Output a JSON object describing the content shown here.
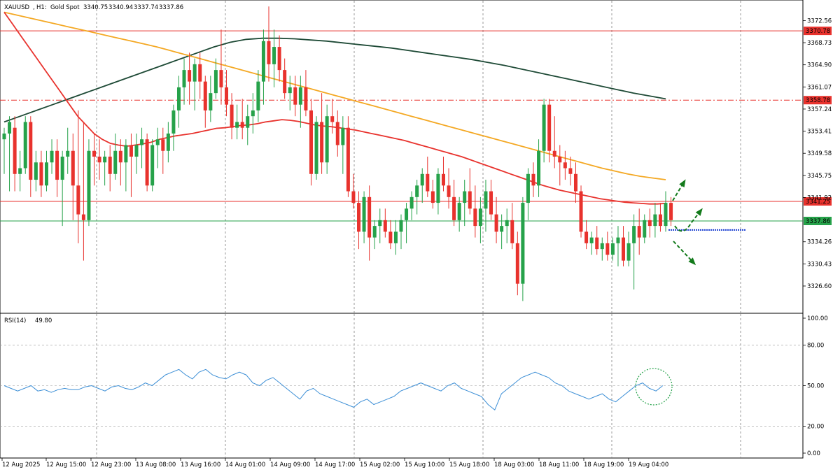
{
  "header": {
    "symbol": "XAUUSD",
    "timeframe": "H1",
    "description": "Gold Spot",
    "open": "3340.75",
    "high": "3340.94",
    "low": "3337.74",
    "close": "3337.86"
  },
  "rsi_header": {
    "name": "RSI(14)",
    "value": "49.80"
  },
  "colors": {
    "bull": "#26a24a",
    "bear": "#e8322d",
    "ma_red": "#e8322d",
    "ma_orange": "#f4a823",
    "ma_dark": "#1e4a36",
    "rsi_line": "#3d8fd6",
    "resistance": "#e8322d",
    "support": "#26a24a",
    "arrow": "#137a1b"
  },
  "price_labels": [
    "3372.56",
    "3368.73",
    "3364.90",
    "3361.07",
    "3357.24",
    "3353.41",
    "3349.58",
    "3345.75",
    "3341.92",
    "3334.26",
    "3330.43",
    "3326.60"
  ],
  "level_labels": [
    {
      "text": "3370.78",
      "price": 3370.78,
      "style": "solid",
      "color": "#e8322d"
    },
    {
      "text": "3358.78",
      "price": 3358.78,
      "style": "dashdot",
      "color": "#e8322d"
    },
    {
      "text": "3341.25",
      "price": 3341.25,
      "style": "solid",
      "color": "#e8322d"
    },
    {
      "text": "3337.86",
      "price": 3337.86,
      "style": "solid",
      "color": "#26a24a"
    }
  ],
  "rsi_labels": [
    "100.00",
    "80.00",
    "50.00",
    "20.00",
    "0.00"
  ],
  "time_labels": [
    "12 Aug 2025",
    "12 Aug 15:00",
    "12 Aug 23:00",
    "13 Aug 08:00",
    "13 Aug 16:00",
    "14 Aug 01:00",
    "14 Aug 09:00",
    "14 Aug 17:00",
    "15 Aug 02:00",
    "15 Aug 10:00",
    "15 Aug 18:00",
    "18 Aug 03:00",
    "18 Aug 11:00",
    "18 Aug 19:00",
    "19 Aug 04:00"
  ],
  "chart_data": {
    "type": "candlestick",
    "ylim": [
      3322.0,
      3376.0
    ],
    "rsi_ylim": [
      0,
      100
    ],
    "candles": [
      [
        3352,
        3354,
        3346,
        3353
      ],
      [
        3353,
        3356,
        3343,
        3355
      ],
      [
        3354,
        3356,
        3343,
        3346
      ],
      [
        3346,
        3350,
        3343,
        3347
      ],
      [
        3347,
        3356,
        3346,
        3355
      ],
      [
        3355,
        3356,
        3342,
        3345
      ],
      [
        3345,
        3350,
        3343,
        3348
      ],
      [
        3348,
        3350,
        3342,
        3344
      ],
      [
        3344,
        3350,
        3343,
        3348
      ],
      [
        3348,
        3352,
        3346,
        3350
      ],
      [
        3350,
        3352,
        3342,
        3345
      ],
      [
        3345,
        3350,
        3337,
        3349
      ],
      [
        3349,
        3354,
        3346,
        3350
      ],
      [
        3350,
        3353,
        3338,
        3344
      ],
      [
        3344,
        3357,
        3334,
        3339
      ],
      [
        3339,
        3355,
        3331,
        3338
      ],
      [
        3338,
        3352,
        3337,
        3350
      ],
      [
        3350,
        3353,
        3344,
        3349
      ],
      [
        3349,
        3352,
        3345,
        3348
      ],
      [
        3348,
        3350,
        3344,
        3349
      ],
      [
        3349,
        3351,
        3343,
        3346
      ],
      [
        3346,
        3353,
        3345,
        3350
      ],
      [
        3350,
        3352,
        3344,
        3348
      ],
      [
        3348,
        3352,
        3343,
        3351
      ],
      [
        3351,
        3353,
        3342,
        3349
      ],
      [
        3349,
        3353,
        3346,
        3351
      ],
      [
        3351,
        3354,
        3347,
        3352
      ],
      [
        3352,
        3353,
        3343,
        3344
      ],
      [
        3344,
        3352,
        3343,
        3351
      ],
      [
        3351,
        3354,
        3347,
        3352
      ],
      [
        3352,
        3354,
        3346,
        3350
      ],
      [
        3350,
        3355,
        3348,
        3353
      ],
      [
        3353,
        3358,
        3350,
        3357
      ],
      [
        3357,
        3363,
        3354,
        3361
      ],
      [
        3361,
        3366,
        3358,
        3364
      ],
      [
        3364,
        3367,
        3358,
        3362
      ],
      [
        3362,
        3366,
        3357,
        3365
      ],
      [
        3365,
        3367,
        3359,
        3362
      ],
      [
        3362,
        3363,
        3354,
        3357
      ],
      [
        3357,
        3363,
        3355,
        3360
      ],
      [
        3360,
        3366,
        3359,
        3364
      ],
      [
        3364,
        3371,
        3358,
        3361
      ],
      [
        3361,
        3364,
        3356,
        3358
      ],
      [
        3358,
        3360,
        3352,
        3354
      ],
      [
        3354,
        3358,
        3352,
        3355
      ],
      [
        3355,
        3359,
        3352,
        3354
      ],
      [
        3354,
        3358,
        3351,
        3356
      ],
      [
        3356,
        3360,
        3353,
        3357
      ],
      [
        3357,
        3364,
        3355,
        3362
      ],
      [
        3362,
        3371,
        3358,
        3369
      ],
      [
        3369,
        3375,
        3362,
        3365
      ],
      [
        3365,
        3371,
        3361,
        3368
      ],
      [
        3368,
        3370,
        3362,
        3364
      ],
      [
        3364,
        3366,
        3359,
        3360
      ],
      [
        3360,
        3363,
        3357,
        3361
      ],
      [
        3361,
        3363,
        3356,
        3358
      ],
      [
        3358,
        3363,
        3354,
        3361
      ],
      [
        3361,
        3364,
        3356,
        3357
      ],
      [
        3357,
        3359,
        3344,
        3346
      ],
      [
        3346,
        3356,
        3345,
        3355
      ],
      [
        3355,
        3360,
        3346,
        3348
      ],
      [
        3348,
        3358,
        3346,
        3356
      ],
      [
        3356,
        3359,
        3353,
        3355
      ],
      [
        3355,
        3357,
        3349,
        3351
      ],
      [
        3351,
        3356,
        3346,
        3354
      ],
      [
        3354,
        3356,
        3342,
        3343
      ],
      [
        3343,
        3346,
        3340,
        3341
      ],
      [
        3341,
        3343,
        3333,
        3336
      ],
      [
        3336,
        3343,
        3334,
        3342
      ],
      [
        3342,
        3344,
        3331,
        3335
      ],
      [
        3335,
        3338,
        3333,
        3337
      ],
      [
        3337,
        3340,
        3334,
        3338
      ],
      [
        3338,
        3340,
        3335,
        3336
      ],
      [
        3336,
        3338,
        3333,
        3334
      ],
      [
        3334,
        3338,
        3332,
        3336
      ],
      [
        3336,
        3339,
        3333,
        3338
      ],
      [
        3338,
        3341,
        3334,
        3340
      ],
      [
        3340,
        3343,
        3338,
        3342
      ],
      [
        3342,
        3345,
        3339,
        3344
      ],
      [
        3344,
        3347,
        3341,
        3346
      ],
      [
        3346,
        3349,
        3342,
        3343
      ],
      [
        3343,
        3345,
        3340,
        3341
      ],
      [
        3341,
        3347,
        3339,
        3346
      ],
      [
        3346,
        3349,
        3343,
        3344
      ],
      [
        3344,
        3347,
        3340,
        3342
      ],
      [
        3342,
        3345,
        3337,
        3338
      ],
      [
        3338,
        3342,
        3336,
        3341
      ],
      [
        3341,
        3345,
        3337,
        3343
      ],
      [
        3343,
        3347,
        3339,
        3340
      ],
      [
        3340,
        3344,
        3335,
        3337
      ],
      [
        3337,
        3342,
        3334,
        3340
      ],
      [
        3340,
        3345,
        3336,
        3343
      ],
      [
        3343,
        3345,
        3338,
        3339
      ],
      [
        3339,
        3342,
        3334,
        3336
      ],
      [
        3336,
        3339,
        3333,
        3337
      ],
      [
        3337,
        3340,
        3334,
        3338
      ],
      [
        3338,
        3341,
        3333,
        3334
      ],
      [
        3334,
        3336,
        3325,
        3327
      ],
      [
        3327,
        3342,
        3324,
        3341
      ],
      [
        3341,
        3347,
        3338,
        3346
      ],
      [
        3346,
        3348,
        3342,
        3344
      ],
      [
        3344,
        3352,
        3342,
        3350
      ],
      [
        3350,
        3359,
        3348,
        3358
      ],
      [
        3358,
        3359,
        3348,
        3350
      ],
      [
        3350,
        3356,
        3347,
        3349
      ],
      [
        3349,
        3351,
        3344,
        3348
      ],
      [
        3348,
        3350,
        3345,
        3347
      ],
      [
        3347,
        3349,
        3344,
        3346
      ],
      [
        3346,
        3348,
        3341,
        3343
      ],
      [
        3343,
        3344,
        3335,
        3336
      ],
      [
        3336,
        3338,
        3333,
        3334
      ],
      [
        3334,
        3336,
        3332,
        3335
      ],
      [
        3335,
        3337,
        3332,
        3333
      ],
      [
        3333,
        3335,
        3331,
        3334
      ],
      [
        3334,
        3336,
        3331,
        3332
      ],
      [
        3332,
        3335,
        3331,
        3334
      ],
      [
        3334,
        3337,
        3330,
        3335
      ],
      [
        3335,
        3337,
        3330,
        3331
      ],
      [
        3331,
        3336,
        3330,
        3334
      ],
      [
        3334,
        3339,
        3326,
        3337
      ],
      [
        3337,
        3340,
        3332,
        3335
      ],
      [
        3335,
        3339,
        3334,
        3338
      ],
      [
        3338,
        3340,
        3335,
        3337
      ],
      [
        3337,
        3341,
        3335,
        3339
      ],
      [
        3339,
        3341,
        3336,
        3337
      ],
      [
        3337,
        3343,
        3336,
        3341
      ],
      [
        3341,
        3342,
        3337,
        3338
      ]
    ],
    "ma_red": [
      3374,
      3372,
      3370,
      3368,
      3366,
      3364,
      3362,
      3360,
      3358,
      3356,
      3354.5,
      3353,
      3352,
      3351.3,
      3351,
      3350.8,
      3351,
      3351.2,
      3351.5,
      3352,
      3352.3,
      3352.6,
      3352.8,
      3353,
      3353.3,
      3353.6,
      3353.9,
      3354,
      3354.2,
      3354.4,
      3354.5,
      3354.7,
      3355,
      3355.2,
      3355.4,
      3355.3,
      3355.1,
      3354.8,
      3354.5,
      3354.3,
      3354.2,
      3354,
      3353.8,
      3353.6,
      3353.3,
      3353,
      3352.7,
      3352.4,
      3352.1,
      3351.8,
      3351.4,
      3351,
      3350.6,
      3350.2,
      3349.8,
      3349.4,
      3349,
      3348.5,
      3348,
      3347.5,
      3347,
      3346.5,
      3346,
      3345.5,
      3345,
      3344.5,
      3344,
      3343.6,
      3343.2,
      3342.9,
      3342.6,
      3342.3,
      3342,
      3341.7,
      3341.5,
      3341.3,
      3341.1,
      3341,
      3340.9,
      3340.8,
      3340.8,
      3340.9
    ],
    "ma_orange": [
      3374,
      3373.5,
      3373,
      3372.5,
      3372,
      3371.5,
      3371,
      3370.5,
      3370,
      3369.5,
      3369,
      3368.5,
      3368,
      3367.4,
      3366.8,
      3366.2,
      3365.6,
      3365,
      3364.4,
      3363.8,
      3363.2,
      3362.6,
      3362,
      3361.4,
      3360.8,
      3360.2,
      3359.6,
      3359,
      3358.4,
      3357.8,
      3357.2,
      3356.6,
      3356,
      3355.4,
      3354.8,
      3354.2,
      3353.6,
      3353,
      3352.4,
      3351.8,
      3351.2,
      3350.6,
      3350,
      3349.4,
      3348.8,
      3348.2,
      3347.6,
      3347,
      3346.5,
      3346,
      3345.6,
      3345.3,
      3345
    ],
    "ma_dark": [
      3355,
      3356,
      3357,
      3358,
      3359,
      3360,
      3361,
      3362,
      3363,
      3364,
      3365,
      3366,
      3367,
      3368,
      3368.8,
      3369.3,
      3369.5,
      3369.5,
      3369.4,
      3369.2,
      3369,
      3368.7,
      3368.4,
      3368.1,
      3367.8,
      3367.4,
      3367,
      3366.6,
      3366.2,
      3365.8,
      3365.3,
      3364.8,
      3364.2,
      3363.6,
      3363,
      3362.4,
      3361.8,
      3361.2,
      3360.6,
      3360,
      3359.5,
      3359
    ],
    "rsi": [
      50,
      48,
      46,
      48,
      50,
      46,
      47,
      45,
      47,
      48,
      47,
      47,
      49,
      50,
      48,
      46,
      49,
      50,
      48,
      47,
      49,
      52,
      50,
      54,
      58,
      60,
      62,
      58,
      55,
      60,
      62,
      58,
      56,
      55,
      58,
      60,
      58,
      52,
      50,
      54,
      56,
      52,
      48,
      44,
      40,
      46,
      48,
      44,
      42,
      40,
      38,
      36,
      34,
      38,
      40,
      36,
      38,
      40,
      42,
      46,
      48,
      50,
      52,
      50,
      48,
      46,
      50,
      52,
      48,
      46,
      44,
      42,
      36,
      32,
      44,
      48,
      52,
      56,
      58,
      60,
      58,
      56,
      52,
      50,
      46,
      44,
      42,
      40,
      42,
      44,
      40,
      38,
      42,
      46,
      50,
      52,
      48,
      46,
      50
    ]
  }
}
